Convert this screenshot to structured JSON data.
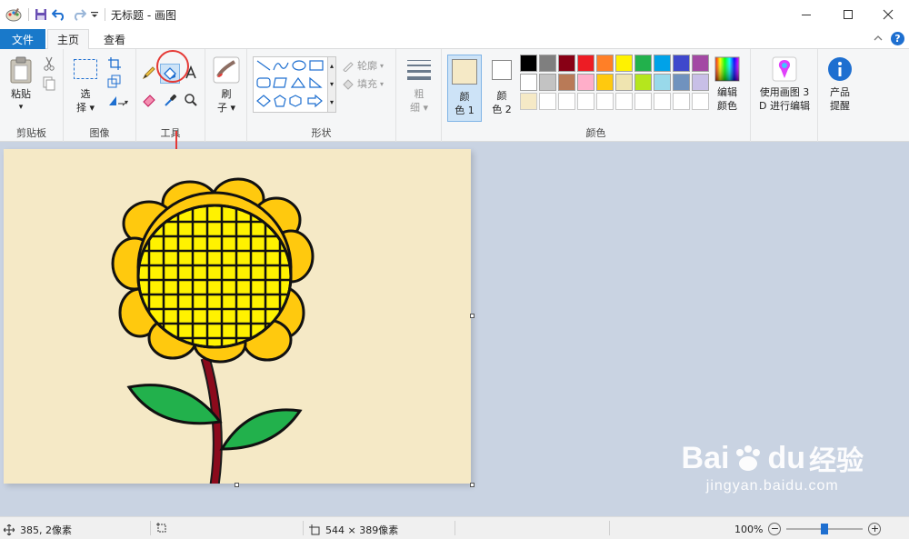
{
  "window": {
    "title": "无标题 - 画图",
    "minimize_icon": "minimize-icon",
    "maximize_icon": "maximize-icon",
    "close_icon": "close-icon"
  },
  "tabs": {
    "file": "文件",
    "home": "主页",
    "view": "查看"
  },
  "ribbon": {
    "clipboard": {
      "label": "剪贴板",
      "paste": "粘贴",
      "paste_arrow": "▾"
    },
    "image": {
      "label": "图像",
      "select": "选",
      "select2": "择"
    },
    "tools": {
      "label": "工具"
    },
    "brushes": {
      "label": "刷",
      "label2": "子"
    },
    "shapes": {
      "label": "形状",
      "outline": "轮廓",
      "fill": "填充"
    },
    "size": {
      "label1": "粗",
      "label2": "细"
    },
    "colors": {
      "label": "颜色",
      "color1": "颜",
      "color1b": "色 1",
      "color2": "颜",
      "color2b": "色 2",
      "edit1": "编辑",
      "edit2": "颜色",
      "color1_value": "#f5e9c6",
      "color2_value": "#ffffff",
      "palette_row1": [
        "#000000",
        "#7f7f7f",
        "#880015",
        "#ed1c24",
        "#ff7f27",
        "#fff200",
        "#22b14c",
        "#00a2e8",
        "#3f48cc",
        "#a349a4"
      ],
      "palette_row2": [
        "#ffffff",
        "#c3c3c3",
        "#b97a57",
        "#ffaec9",
        "#ffc90e",
        "#efe4b0",
        "#b5e61d",
        "#99d9ea",
        "#7092be",
        "#c8bfe7"
      ],
      "palette_row3_first": "#f5e9c6"
    },
    "paint3d": {
      "line1": "使用画图 3",
      "line2": "D 进行编辑"
    },
    "tips": {
      "line1": "产品",
      "line2": "提醒"
    }
  },
  "statusbar": {
    "cursor_pos": "385, 2像素",
    "canvas_size": "544 × 389像素",
    "zoom": "100%",
    "zoom_level": 0.5
  },
  "watermark": {
    "brand": "Bai",
    "brand2": "du",
    "cn": "经验",
    "url": "jingyan.baidu.com"
  }
}
